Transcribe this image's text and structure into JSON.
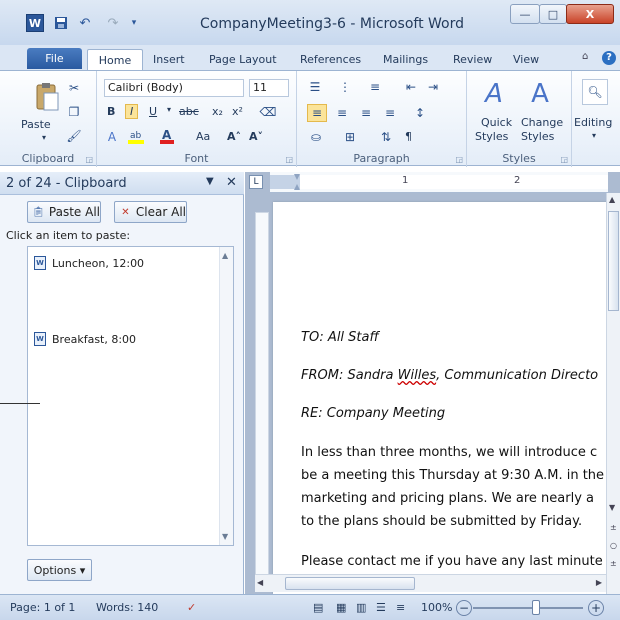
{
  "window": {
    "title": "CompanyMeeting3-6 - Microsoft Word",
    "app_icon": "W",
    "min": "—",
    "max": "□",
    "close": "X"
  },
  "tabs": [
    "File",
    "Home",
    "Insert",
    "Page Layout",
    "References",
    "Mailings",
    "Review",
    "View"
  ],
  "ribbon": {
    "clipboard": {
      "paste": "Paste",
      "label": "Clipboard"
    },
    "font": {
      "name": "Calibri (Body)",
      "size": "11",
      "label": "Font",
      "bold": "B",
      "italic": "I",
      "underline": "U",
      "strike": "abc",
      "sub": "x₂",
      "sup": "x²",
      "grow": "A˄",
      "shrink": "A˅",
      "case": "Aa"
    },
    "paragraph": {
      "label": "Paragraph",
      "pilcrow": "¶"
    },
    "styles": {
      "quick": "Quick",
      "quick2": "Styles",
      "change": "Change",
      "change2": "Styles",
      "label": "Styles"
    },
    "editing": {
      "label": "Editing"
    }
  },
  "pane": {
    "title": "2 of 24 - Clipboard",
    "paste_all": "Paste All",
    "clear_all": "Clear All",
    "instruction": "Click an item to paste:",
    "items": [
      "Luncheon, 12:00",
      "Breakfast, 8:00"
    ],
    "options": "Options ▾"
  },
  "ruler": {
    "marks": [
      "1",
      "2"
    ]
  },
  "document": {
    "to": "TO: All Staff",
    "from_a": "FROM: Sandra ",
    "from_b": "Willes",
    "from_c": ", Communication Directo",
    "re": "RE: Company Meeting",
    "p1": "In less than three months, we will introduce c",
    "p2": "be a meeting this Thursday at 9:30 A.M. in the",
    "p3": "marketing and pricing plans. We are nearly a",
    "p4": "to the plans should be submitted  by Friday.",
    "p5": "Please contact me if you have any last minute"
  },
  "status": {
    "page": "Page: 1 of 1",
    "words": "Words: 140",
    "zoom": "100%",
    "minus": "−",
    "plus": "+"
  }
}
